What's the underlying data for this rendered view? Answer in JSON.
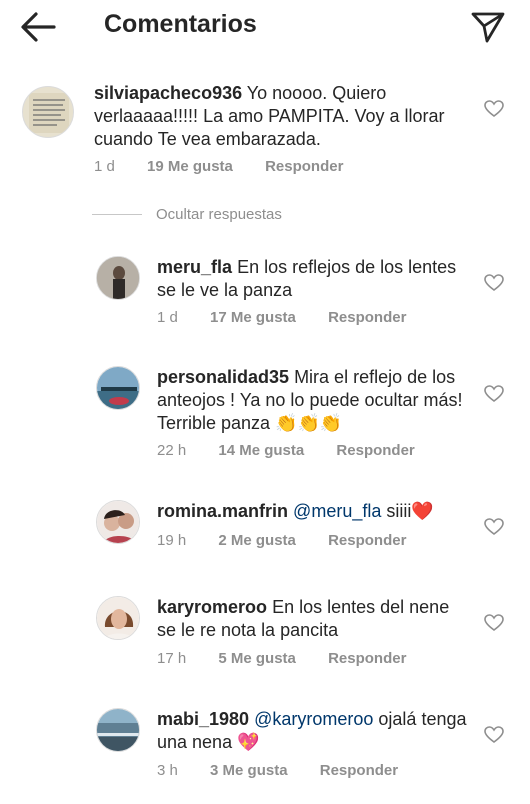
{
  "header": {
    "title": "Comentarios",
    "back_icon": "arrow-left-icon",
    "send_icon": "paper-plane-icon"
  },
  "hide_replies": "Ocultar respuestas",
  "comments": [
    {
      "user": "silviapacheco936",
      "text": "Yo noooo. Quiero verlaaaaa!!!!! La amo PAMPITA. Voy a llorar cuando  Te vea embarazada.",
      "mention": "",
      "emoji": "",
      "time": "1 d",
      "likes": "19 Me gusta",
      "reply": "Responder"
    },
    {
      "user": "meru_fla",
      "text": "En los reflejos de los lentes se le ve la panza",
      "mention": "",
      "emoji": "",
      "time": "1 d",
      "likes": "17 Me gusta",
      "reply": "Responder"
    },
    {
      "user": "personalidad35",
      "text": "Mira el reflejo de los anteojos ! Ya no lo puede ocultar más! Terrible panza ",
      "mention": "",
      "emoji": "👏👏👏",
      "time": "22 h",
      "likes": "14 Me gusta",
      "reply": "Responder"
    },
    {
      "user": "romina.manfrin",
      "text": " siiii",
      "mention": "@meru_fla",
      "emoji": "❤️",
      "time": "19 h",
      "likes": "2 Me gusta",
      "reply": "Responder"
    },
    {
      "user": "karyromeroo",
      "text": "En los lentes del nene se le re nota la pancita",
      "mention": "",
      "emoji": "",
      "time": "17 h",
      "likes": "5 Me gusta",
      "reply": "Responder"
    },
    {
      "user": "mabi_1980",
      "text": " ojalá tenga una nena ",
      "mention": "@karyromeroo",
      "emoji": "💖",
      "time": "3 h",
      "likes": "3 Me gusta",
      "reply": "Responder"
    }
  ],
  "colors": {
    "text": "#262626",
    "meta": "#8e8e8e",
    "mention": "#00376b",
    "divider": "#c7c7c7"
  }
}
